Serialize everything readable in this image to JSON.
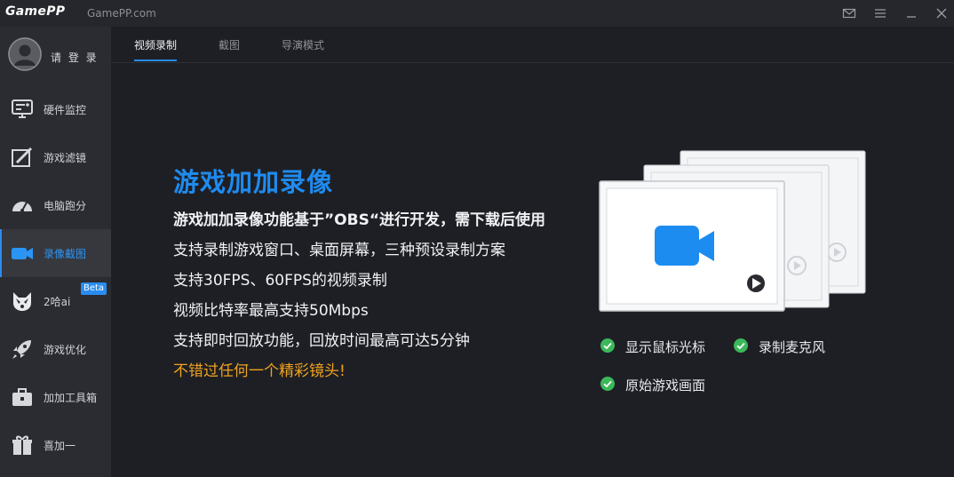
{
  "app": {
    "logo": "GamePP",
    "site": "GamePP.com"
  },
  "titlebar": {
    "icons": [
      "mail-icon",
      "menu-icon",
      "minimize-icon",
      "close-icon"
    ]
  },
  "sidebar": {
    "login_label": "请 登 录",
    "items": [
      {
        "label": "硬件监控",
        "icon": "hardware-monitor-icon"
      },
      {
        "label": "游戏滤镜",
        "icon": "game-filter-icon"
      },
      {
        "label": "电脑跑分",
        "icon": "benchmark-gauge-icon"
      },
      {
        "label": "录像截图",
        "icon": "video-camera-icon",
        "active": true
      },
      {
        "label": "2哈ai",
        "icon": "husky-icon",
        "badge": "Beta"
      },
      {
        "label": "游戏优化",
        "icon": "rocket-icon"
      },
      {
        "label": "加加工具箱",
        "icon": "toolbox-icon"
      },
      {
        "label": "喜加一",
        "icon": "gift-icon"
      }
    ]
  },
  "tabs": [
    {
      "label": "视频录制",
      "active": true
    },
    {
      "label": "截图"
    },
    {
      "label": "导演模式"
    }
  ],
  "main": {
    "title": "游戏加加录像",
    "lines": [
      "游戏加加录像功能基于”OBS“进行开发，需下载后使用",
      "支持录制游戏窗口、桌面屏幕，三种预设录制方案",
      "支持30FPS、60FPS的视频录制",
      "视频比特率最高支持50Mbps",
      "支持即时回放功能，回放时间最高可达5分钟"
    ],
    "tagline": "不错过任何一个精彩镜头!",
    "features": [
      "显示鼠标光标",
      "录制麦克风",
      "原始游戏画面"
    ]
  },
  "colors": {
    "accent": "#2a8cf0",
    "highlight": "#f0a21f",
    "check": "#3cb85a",
    "bg": "#1e1f24",
    "sidebar": "#2b2c31"
  }
}
